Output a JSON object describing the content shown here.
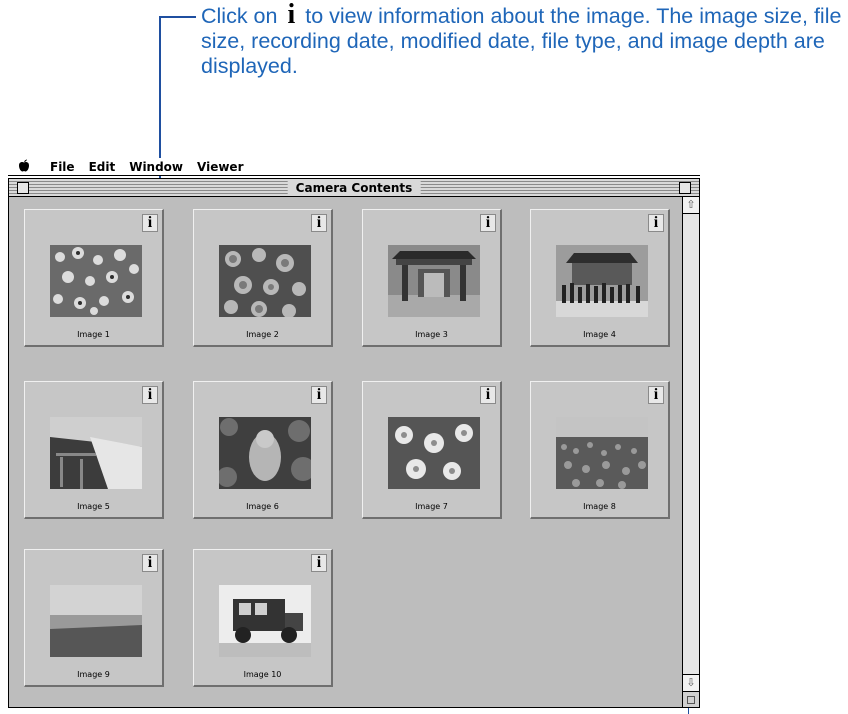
{
  "callout": {
    "text_before": "Click on",
    "icon_glyph": "i",
    "text_after": "to view information about the image. The image size, file size, recording date, modified date, file type, and image depth are displayed."
  },
  "menubar": {
    "apple_icon": "apple-icon",
    "items": [
      "File",
      "Edit",
      "Window",
      "Viewer"
    ]
  },
  "window": {
    "title": "Camera Contents"
  },
  "info_button_glyph": "i",
  "images": [
    {
      "label": "Image 1",
      "subject": "flowers"
    },
    {
      "label": "Image 2",
      "subject": "flowers"
    },
    {
      "label": "Image 3",
      "subject": "shrine gate"
    },
    {
      "label": "Image 4",
      "subject": "crowd at temple"
    },
    {
      "label": "Image 5",
      "subject": "waterfall"
    },
    {
      "label": "Image 6",
      "subject": "statue in foliage"
    },
    {
      "label": "Image 7",
      "subject": "daisies"
    },
    {
      "label": "Image 8",
      "subject": "flower field"
    },
    {
      "label": "Image 9",
      "subject": "seaside"
    },
    {
      "label": "Image 10",
      "subject": "old truck"
    }
  ],
  "scrollbar": {
    "up_arrow": "up-arrow-icon",
    "down_arrow": "down-arrow-icon",
    "grow_box": "resize-icon"
  }
}
